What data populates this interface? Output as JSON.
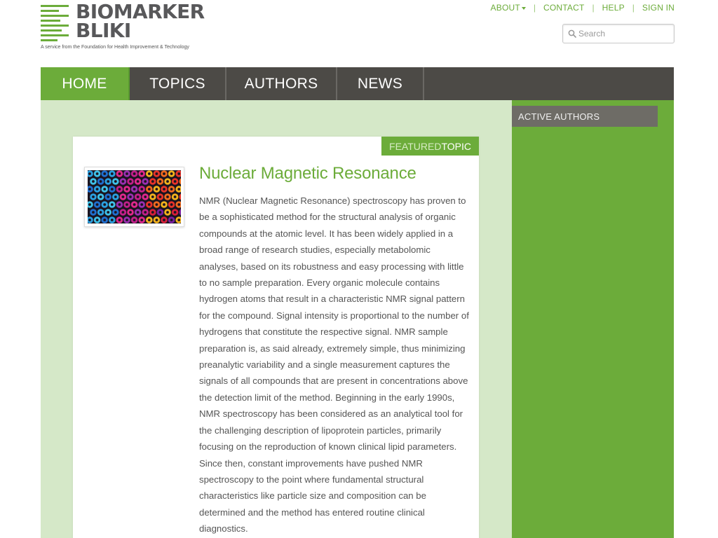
{
  "logo": {
    "line1": "BIOMARKER",
    "line2": "BLIKI",
    "tagline": "A service from the Foundation for Health Improvement & Technology",
    "icon": "biomarker-bars-logo",
    "color": "#6cac3a"
  },
  "top_links": [
    {
      "label": "ABOUT",
      "has_dropdown": true
    },
    {
      "label": "CONTACT"
    },
    {
      "label": "HELP"
    },
    {
      "label": "SIGN IN"
    }
  ],
  "search": {
    "placeholder": "Search",
    "value": "",
    "icon": "search-icon"
  },
  "nav": {
    "items": [
      {
        "label": "HOME",
        "active": true
      },
      {
        "label": "TOPICS"
      },
      {
        "label": "AUTHORS"
      },
      {
        "label": "NEWS"
      }
    ]
  },
  "featured": {
    "badge_part1": "FEATURED",
    "badge_part2": "TOPIC",
    "title": "Nuclear Magnetic Resonance",
    "image": "colorful-tubes-photo",
    "body": "NMR (Nuclear Magnetic Resonance) spectroscopy has proven to be a sophisticated method for the structural analysis of organic compounds at the atomic level. It has been widely applied in a broad range of research studies, especially metabolomic analyses, based on its robustness and easy processing with little to no sample preparation. Every organic molecule contains hydrogen atoms that result in a characteristic NMR signal pattern for the compound. Signal intensity is proportional to the number of hydrogens that constitute the respective signal. NMR sample preparation is, as said already, extremely simple, thus minimizing preanalytic variability and a single measurement captures the signals of all compounds that are present in concentrations above the detection limit of the method. Beginning in the early 1990s, NMR spectroscopy has been considered as an analytical tool for the challenging description of lipoprotein particles, primarily focusing on the reproduction of known clinical lipid parameters. Since then, constant improvements have pushed NMR spectroscopy to the point where fundamental structural characteristics like particle size and composition can be determined and the method has entered routine clinical diagnostics."
  },
  "sidebar": {
    "heading": "ACTIVE AUTHORS"
  },
  "colors": {
    "brand_green": "#6cac3a",
    "nav_dark": "#4c4a46",
    "light_green_bg": "#d5e8c8",
    "sidebar_head": "#6e6c66"
  }
}
